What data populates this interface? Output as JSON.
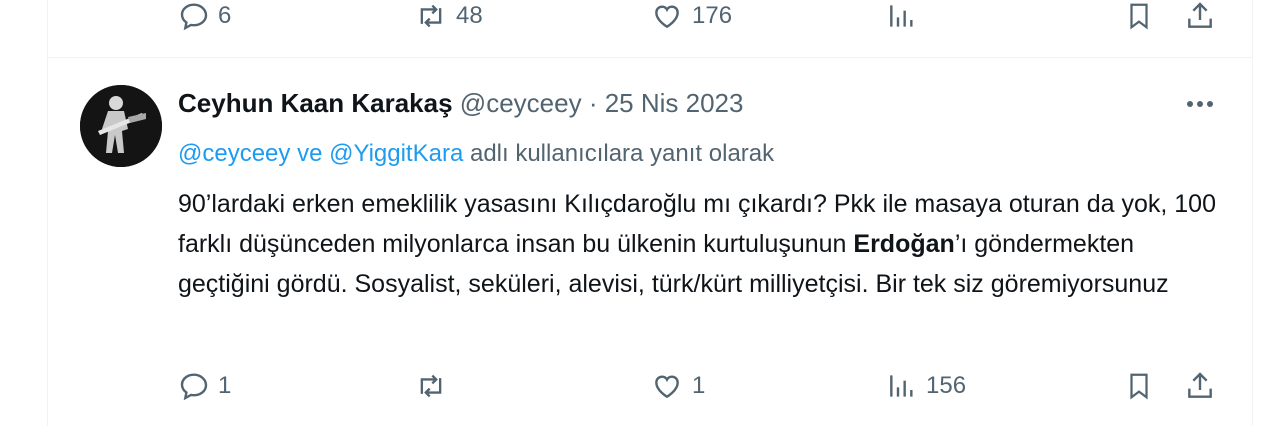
{
  "previous_tweet": {
    "actions": {
      "replies": "6",
      "retweets": "48",
      "likes": "176",
      "views": ""
    }
  },
  "tweet": {
    "display_name": "Ceyhun Kaan Karakaş",
    "handle": "@ceyceey",
    "separator": "·",
    "date": "25 Nis 2023",
    "reply_to": {
      "mention1": "@ceyceey",
      "connector": " ve ",
      "mention2": "@YiggitKara",
      "suffix": " adlı kullanıcılara yanıt olarak"
    },
    "body": {
      "part1": "90’lardaki erken emeklilik yasasını Kılıçdaroğlu mı çıkardı? Pkk ile masaya oturan da yok, 100 farklı düşünceden milyonlarca insan bu ülkenin kurtuluşunun ",
      "bold": "Erdoğan",
      "part2": "’ı göndermekten geçtiğini gördü. Sosyalist, seküleri, alevisi, türk/kürt milliyetçisi. Bir tek siz göremiyorsunuz"
    },
    "actions": {
      "replies": "1",
      "retweets": "",
      "likes": "1",
      "views": "156"
    }
  },
  "icons": {
    "reply": "speech-bubble-icon",
    "retweet": "retweet-icon",
    "like": "heart-icon",
    "views": "bar-chart-icon",
    "bookmark": "bookmark-icon",
    "share": "share-icon",
    "more": "more-icon"
  },
  "colors": {
    "link": "#1d9bf0",
    "muted": "#536471",
    "text": "#0f1419",
    "border": "#eff3f4"
  }
}
